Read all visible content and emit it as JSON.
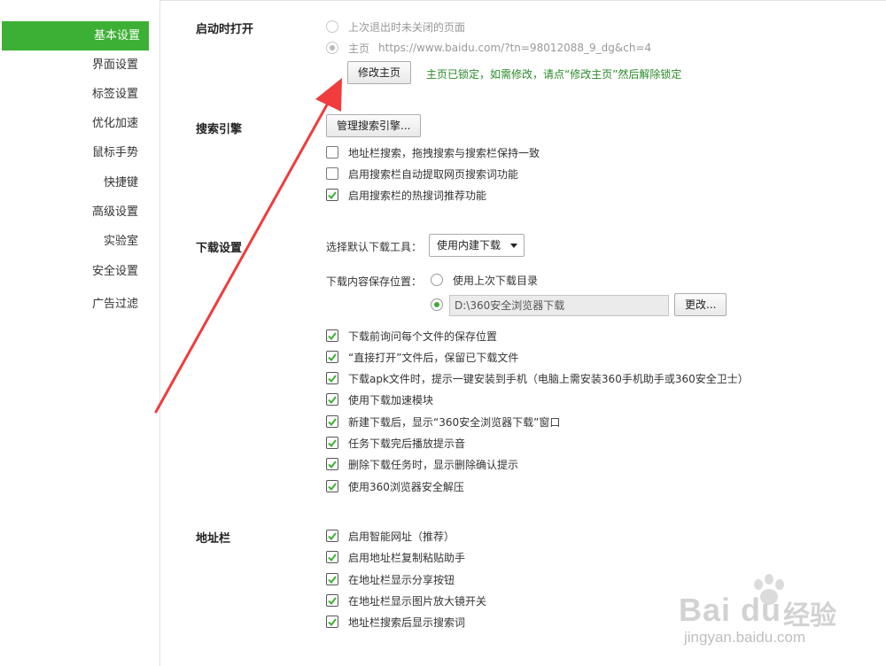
{
  "sidebar": {
    "items": [
      {
        "label": "基本设置",
        "active": true
      },
      {
        "label": "界面设置",
        "active": false
      },
      {
        "label": "标签设置",
        "active": false
      },
      {
        "label": "优化加速",
        "active": false
      },
      {
        "label": "鼠标手势",
        "active": false
      },
      {
        "label": "快捷键",
        "active": false
      },
      {
        "label": "高级设置",
        "active": false
      },
      {
        "label": "实验室",
        "active": false
      },
      {
        "label": "安全设置",
        "active": false
      },
      {
        "label": "广告过滤",
        "active": false
      }
    ]
  },
  "startup": {
    "title": "启动时打开",
    "option_last_session": "上次退出时未关闭的页面",
    "option_homepage_label": "主页",
    "homepage_url": "https://www.baidu.com/?tn=98012088_9_dg&ch=4",
    "modify_button": "修改主页",
    "locked_note": "主页已锁定，如需修改，请点“修改主页”然后解除锁定"
  },
  "search": {
    "title": "搜索引擎",
    "manage_button": "管理搜索引擎...",
    "options": [
      {
        "label": "地址栏搜索，拖拽搜索与搜索栏保持一致",
        "checked": false
      },
      {
        "label": "启用搜索栏自动提取网页搜索词功能",
        "checked": false
      },
      {
        "label": "启用搜索栏的热搜词推荐功能",
        "checked": true
      }
    ]
  },
  "download": {
    "title": "下载设置",
    "tool_label": "选择默认下载工具：",
    "tool_value": "使用内建下载",
    "location_label": "下载内容保存位置：",
    "location_last": "使用上次下载目录",
    "location_path": "D:\\360安全浏览器下载",
    "change_button": "更改...",
    "options": [
      {
        "label": "下载前询问每个文件的保存位置",
        "checked": true
      },
      {
        "label": "“直接打开”文件后，保留已下载文件",
        "checked": true
      },
      {
        "label": "下载apk文件时，提示一键安装到手机（电脑上需安装360手机助手或360安全卫士）",
        "checked": true
      },
      {
        "label": "使用下载加速模块",
        "checked": true
      },
      {
        "label": "新建下载后，显示“360安全浏览器下载”窗口",
        "checked": true
      },
      {
        "label": "任务下载完后播放提示音",
        "checked": true
      },
      {
        "label": "删除下载任务时，显示删除确认提示",
        "checked": true
      },
      {
        "label": "使用360浏览器安全解压",
        "checked": true
      }
    ]
  },
  "addressbar": {
    "title": "地址栏",
    "options": [
      {
        "label": "启用智能网址（推荐）",
        "checked": true
      },
      {
        "label": "启用地址栏复制粘贴助手",
        "checked": true
      },
      {
        "label": "在地址栏显示分享按钮",
        "checked": true
      },
      {
        "label": "在地址栏显示图片放大镜开关",
        "checked": true
      },
      {
        "label": "地址栏搜索后显示搜索词",
        "checked": true
      }
    ]
  },
  "watermark": {
    "brand": "Bai  du",
    "text": "经验",
    "url": "jingyan.baidu.com"
  },
  "colors": {
    "accent": "#3cb034",
    "note_green": "#2a8a2a",
    "arrow_red": "#f03c3c"
  }
}
